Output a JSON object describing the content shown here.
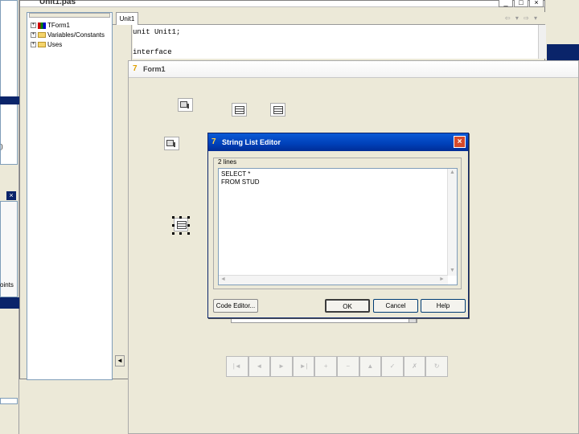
{
  "unit_window": {
    "title": "Unit1.pas",
    "caption_buttons": [
      "_",
      "□",
      "×"
    ],
    "explorer": {
      "items": [
        "TForm1",
        "Variables/Constants",
        "Uses"
      ]
    },
    "editor": {
      "tab": "Unit1",
      "nav": "⇦ ▾ ⇨ ▾",
      "lines": [
        "unit Unit1;",
        "",
        "interface"
      ]
    }
  },
  "left_panel": {
    "label": "oints",
    "close": "×",
    "paren": ")"
  },
  "form1": {
    "title": "Form1",
    "navigator_buttons": [
      "|◄",
      "◄",
      "►",
      "►|",
      "+",
      "−",
      "▲",
      "✓",
      "✗",
      "↻"
    ]
  },
  "dialog": {
    "title": "String List Editor",
    "close": "×",
    "lines_count": "2 lines",
    "memo_lines": [
      "SELECT *",
      "FROM STUD"
    ],
    "buttons": {
      "code_editor": "Code Editor...",
      "ok": "OK",
      "cancel": "Cancel",
      "help": "Help"
    }
  }
}
